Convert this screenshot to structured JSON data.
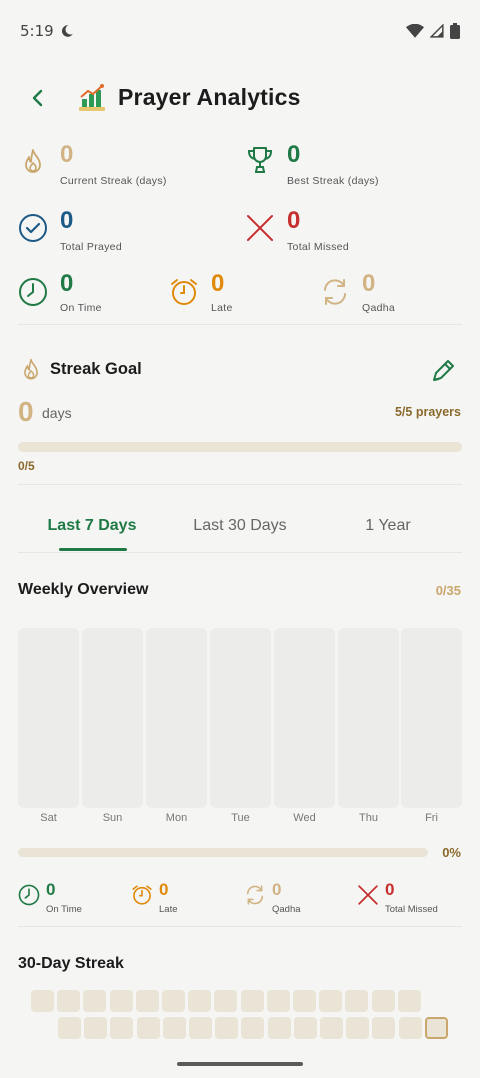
{
  "status_bar": {
    "time": "5:19"
  },
  "header": {
    "title": "Prayer Analytics"
  },
  "stats": {
    "current_streak": {
      "value": "0",
      "label": "Current Streak (days)"
    },
    "best_streak": {
      "value": "0",
      "label": "Best Streak (days)"
    },
    "total_prayed": {
      "value": "0",
      "label": "Total Prayed"
    },
    "total_missed": {
      "value": "0",
      "label": "Total Missed"
    },
    "on_time": {
      "value": "0",
      "label": "On Time"
    },
    "late": {
      "value": "0",
      "label": "Late"
    },
    "qadha": {
      "value": "0",
      "label": "Qadha"
    }
  },
  "streak_goal": {
    "title": "Streak Goal",
    "days_value": "0",
    "days_label": "days",
    "prayers": "5/5 prayers",
    "progress_text": "0/5",
    "progress_fraction": 0
  },
  "tabs": [
    {
      "label": "Last 7 Days",
      "active": true
    },
    {
      "label": "Last 30 Days",
      "active": false
    },
    {
      "label": "1 Year",
      "active": false
    }
  ],
  "weekly": {
    "title": "Weekly Overview",
    "count": "0/35",
    "days": [
      "Sat",
      "Sun",
      "Mon",
      "Tue",
      "Wed",
      "Thu",
      "Fri"
    ],
    "values": [
      0,
      0,
      0,
      0,
      0,
      0,
      0
    ],
    "percent": "0%",
    "progress_fraction": 0
  },
  "weekly_stats": {
    "on_time": {
      "value": "0",
      "label": "On Time"
    },
    "late": {
      "value": "0",
      "label": "Late"
    },
    "qadha": {
      "value": "0",
      "label": "Qadha"
    },
    "total_missed": {
      "value": "0",
      "label": "Total Missed"
    }
  },
  "streak_30": {
    "title": "30-Day Streak",
    "days_completed": 0,
    "total_days": 30
  },
  "colors": {
    "green": "#1f7a45",
    "gold": "#c9a66b",
    "blue": "#1e5a86",
    "red": "#c62f2f",
    "orange": "#e08a0c",
    "brown": "#8a6a2c"
  },
  "icons": {
    "back": "chevron-left-icon",
    "title": "chart-icon",
    "current_streak": "flame-icon",
    "best_streak": "trophy-icon",
    "total_prayed": "check-circle-icon",
    "total_missed": "x-icon",
    "on_time": "clock-icon",
    "late": "alarm-clock-icon",
    "qadha": "refresh-icon",
    "streak_goal": "flame-icon",
    "edit": "pencil-icon"
  }
}
